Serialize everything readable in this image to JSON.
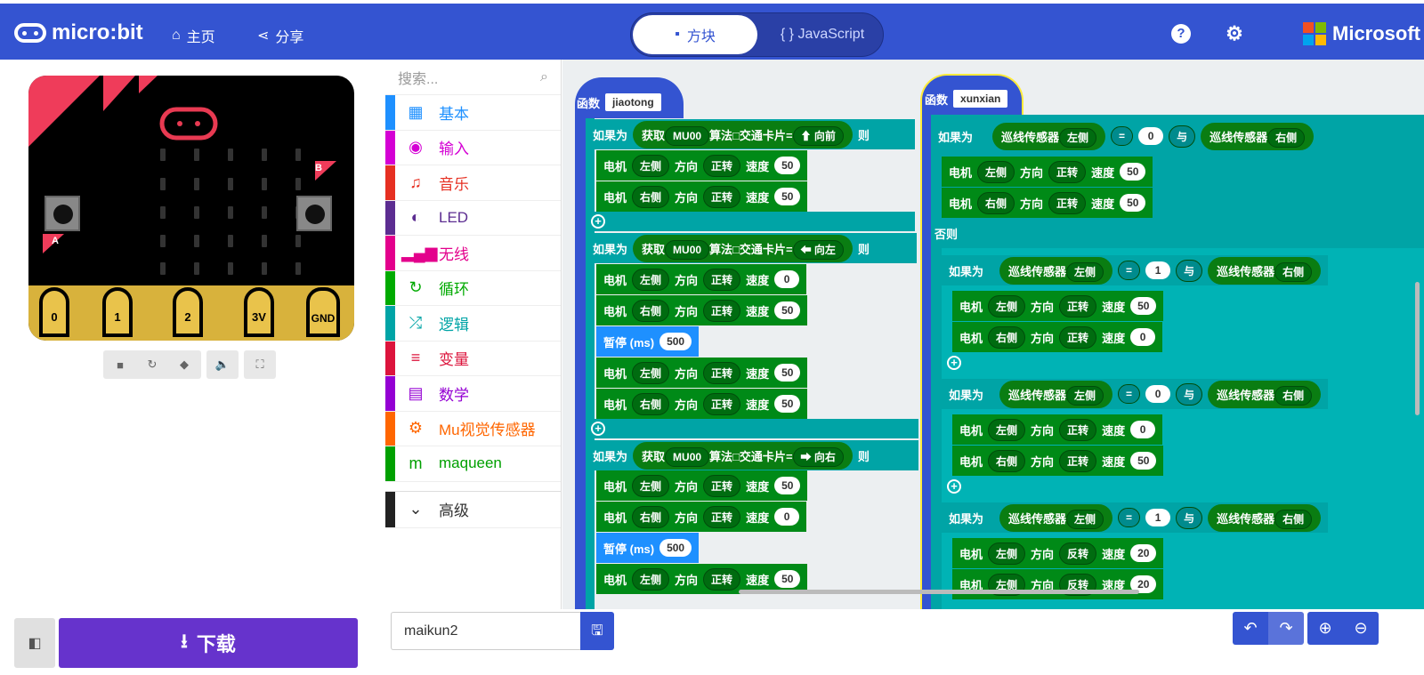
{
  "header": {
    "logo": "micro:bit",
    "home": "主页",
    "share": "分享",
    "tab_blocks": "方块",
    "tab_js": "{ } JavaScript",
    "help": "?",
    "brand": "Microsoft"
  },
  "colors": {
    "header": "#3454d1",
    "download": "#6633cc"
  },
  "sim": {
    "pins": [
      "0",
      "1",
      "2",
      "3V",
      "GND"
    ],
    "btn_a": "A",
    "btn_b": "B"
  },
  "toolbox": {
    "placeholder": "搜索...",
    "categories": [
      {
        "label": "基本",
        "color": "#1e90ff",
        "icon": "grid-icon"
      },
      {
        "label": "输入",
        "color": "#d400d4",
        "icon": "target-icon"
      },
      {
        "label": "音乐",
        "color": "#e63022",
        "icon": "headphones-icon"
      },
      {
        "label": "LED",
        "color": "#5c2d91",
        "icon": "toggle-icon"
      },
      {
        "label": "无线",
        "color": "#e3008c",
        "icon": "signal-icon"
      },
      {
        "label": "循环",
        "color": "#00aa00",
        "icon": "refresh-icon"
      },
      {
        "label": "逻辑",
        "color": "#00a4a6",
        "icon": "shuffle-icon"
      },
      {
        "label": "变量",
        "color": "#dc143c",
        "icon": "list-icon"
      },
      {
        "label": "数学",
        "color": "#9400d3",
        "icon": "calculator-icon"
      },
      {
        "label": "Mu视觉传感器",
        "color": "#ff6600",
        "icon": "gears-icon"
      },
      {
        "label": "maqueen",
        "color": "#00a000",
        "icon": "m-icon"
      }
    ],
    "advanced": "高级"
  },
  "ws": {
    "func": "函数",
    "f1": "jiaotong",
    "f2": "xunxian",
    "if": "如果为",
    "then": "则",
    "else": "否则",
    "get": "获取",
    "mu": "MU00",
    "algo": "算法",
    "card": "交通卡片",
    "eq": "=",
    "fwd": "⬆ 向前",
    "left": "⬅ 向左",
    "right": "➡ 向右",
    "motor": "电机",
    "l": "左侧",
    "r": "右侧",
    "dir": "方向",
    "fw": "正转",
    "rv": "反转",
    "speed": "速度",
    "pause": "暂停 (ms)",
    "p500": "500",
    "line": "巡线传感器",
    "and": "与",
    "v50": "50",
    "v0": "0",
    "v1": "1",
    "v20": "20"
  },
  "bottom": {
    "download": "下载",
    "filename": "maikun2"
  }
}
